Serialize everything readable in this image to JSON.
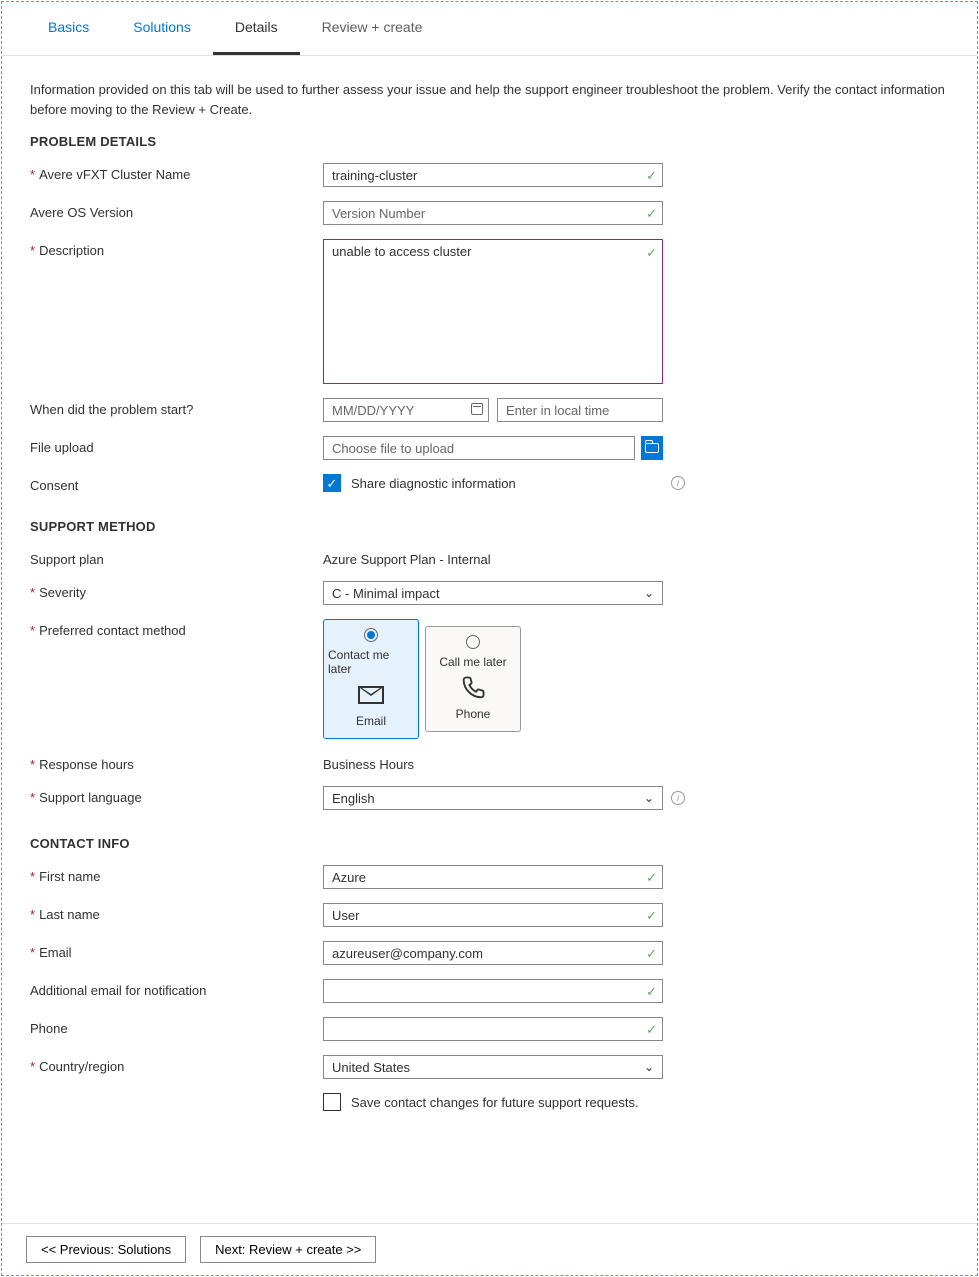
{
  "tabs": {
    "basics": "Basics",
    "solutions": "Solutions",
    "details": "Details",
    "review": "Review + create"
  },
  "intro": "Information provided on this tab will be used to further assess your issue and help the support engineer troubleshoot the problem. Verify the contact information before moving to the Review + Create.",
  "sections": {
    "problem": "PROBLEM DETAILS",
    "support": "SUPPORT METHOD",
    "contact": "CONTACT INFO"
  },
  "labels": {
    "cluster": "Avere vFXT Cluster Name",
    "os": "Avere OS Version",
    "desc": "Description",
    "when": "When did the problem start?",
    "file": "File upload",
    "consent": "Consent",
    "plan": "Support plan",
    "severity": "Severity",
    "contactMethod": "Preferred contact method",
    "hours": "Response hours",
    "lang": "Support language",
    "first": "First name",
    "last": "Last name",
    "email": "Email",
    "addEmail": "Additional email for notification",
    "phone": "Phone",
    "country": "Country/region"
  },
  "values": {
    "cluster": "training-cluster",
    "desc": "unable to access cluster",
    "plan": "Azure Support Plan - Internal",
    "severity": "C - Minimal impact",
    "hours": "Business Hours",
    "lang": "English",
    "first": "Azure",
    "last": "User",
    "email": "azureuser@company.com",
    "country": "United States"
  },
  "placeholders": {
    "os": "Version Number",
    "date": "MM/DD/YYYY",
    "time": "Enter in local time",
    "file": "Choose file to upload"
  },
  "checkbox": {
    "consent": "Share diagnostic information",
    "saveContact": "Save contact changes for future support requests."
  },
  "contactCards": {
    "later": "Contact me later",
    "email": "Email",
    "call": "Call me later",
    "phone": "Phone"
  },
  "footer": {
    "prev": "<< Previous: Solutions",
    "next": "Next: Review + create >>"
  }
}
